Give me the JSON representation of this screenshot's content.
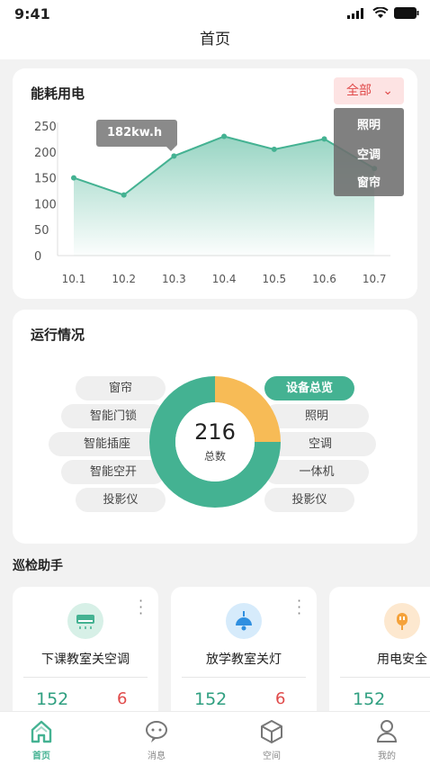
{
  "status": {
    "time": "9:41"
  },
  "header": {
    "title": "首页"
  },
  "energy": {
    "title": "能耗用电",
    "dropdown": {
      "selected": "全部",
      "options": [
        "照明",
        "空调",
        "窗帘"
      ]
    },
    "tooltip": "182kw.h"
  },
  "chart_data": {
    "type": "line",
    "x": [
      "10.1",
      "10.2",
      "10.3",
      "10.4",
      "10.5",
      "10.6",
      "10.7"
    ],
    "values": [
      150,
      117,
      192,
      230,
      205,
      225,
      168
    ],
    "ylim": [
      0,
      250
    ],
    "yticks": [
      "250",
      "200",
      "150",
      "100",
      "50",
      "0"
    ],
    "color": "#44b292",
    "grid": false
  },
  "status_panel": {
    "title": "运行情况",
    "total": "216",
    "total_label": "总数",
    "left_items": [
      "窗帘",
      "智能门锁",
      "智能插座",
      "智能空开",
      "投影仪"
    ],
    "right_items": [
      "设备总览",
      "照明",
      "空调",
      "一体机",
      "投影仪"
    ],
    "donut": [
      {
        "share": 0.25,
        "color": "#f7bb56"
      },
      {
        "share": 0.75,
        "color": "#44b292"
      }
    ]
  },
  "patrol": {
    "title": "巡检助手",
    "cards": [
      {
        "title": "下课教室关空调",
        "n1": "152",
        "n2": "6"
      },
      {
        "title": "放学教室关灯",
        "n1": "152",
        "n2": "6"
      },
      {
        "title": "用电安全",
        "n1": "152",
        "n2": ""
      }
    ]
  },
  "tabs": [
    {
      "label": "首页",
      "active": true
    },
    {
      "label": "消息"
    },
    {
      "label": "空间"
    },
    {
      "label": "我的"
    }
  ]
}
